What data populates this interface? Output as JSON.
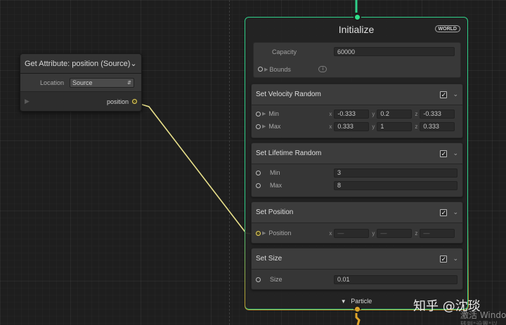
{
  "get_attribute_node": {
    "title": "Get Attribute: position (Source)",
    "location_label": "Location",
    "location_value": "Source",
    "output_label": "position"
  },
  "context": {
    "title": "Initialize",
    "space_badge": "WORLD",
    "capacity_label": "Capacity",
    "capacity_value": "60000",
    "bounds_label": "Bounds",
    "bounds_icon": "info-icon",
    "footer_label": "Particle",
    "blocks": [
      {
        "title": "Set Velocity Random",
        "enabled": true,
        "rows": [
          {
            "label": "Min",
            "x": "-0.333",
            "y": "0.2",
            "z": "-0.333"
          },
          {
            "label": "Max",
            "x": "0.333",
            "y": "1",
            "z": "0.333"
          }
        ]
      },
      {
        "title": "Set Lifetime Random",
        "enabled": true,
        "rows": [
          {
            "label": "Min",
            "value": "3"
          },
          {
            "label": "Max",
            "value": "8"
          }
        ]
      },
      {
        "title": "Set Position",
        "enabled": true,
        "rows": [
          {
            "label": "Position",
            "x": "—",
            "y": "—",
            "z": "—"
          }
        ]
      },
      {
        "title": "Set Size",
        "enabled": true,
        "rows": [
          {
            "label": "Size",
            "value": "0.01"
          }
        ]
      }
    ]
  },
  "axis_labels": {
    "x": "x",
    "y": "y",
    "z": "z"
  },
  "watermark": {
    "text": "知乎 @沈琰",
    "windows_line1": "激活 Windo",
    "windows_line2": "转到\"设置\"以"
  },
  "colors": {
    "flow_in": "#2fd089",
    "flow_out": "#e0a52a",
    "wire_position": "#e8e08a"
  }
}
